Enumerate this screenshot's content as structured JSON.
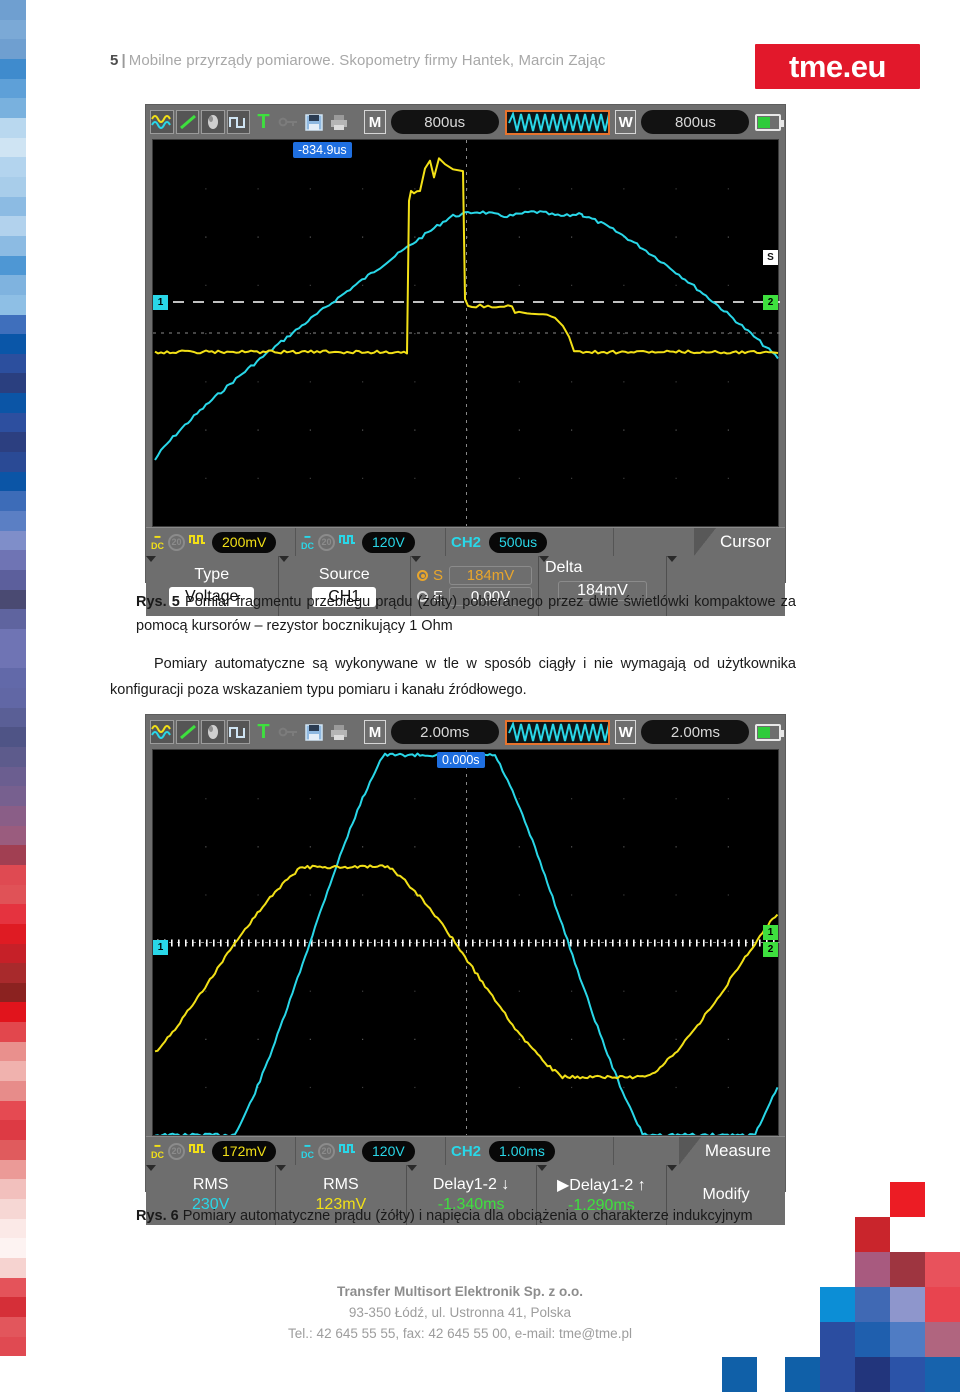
{
  "header": {
    "page_number": "5",
    "separator": "|",
    "title": "Mobilne przyrządy pomiarowe. Skopometry firmy Hantek, Marcin Zając",
    "logo_text": "tme.eu",
    "logo_color": "#e2182b"
  },
  "scope1": {
    "topbar": {
      "icons": [
        "waveform-icon",
        "slope-icon",
        "image-icon",
        "pulse-icon",
        "trigger-t-icon",
        "key-icon",
        "save-icon",
        "print-icon"
      ],
      "m_button": "M",
      "m_value": "800us",
      "w_button": "W",
      "w_value": "800us",
      "battery": "battery-icon"
    },
    "time_cursor_label": "-834.9us",
    "channel_markers": {
      "left": "1",
      "right": "2",
      "trig_level": "S"
    },
    "chanbar": {
      "ch1_coupling": "DC",
      "ch1_bw": "20",
      "ch1_probe": "probe-icon",
      "ch1_scale": "200mV",
      "ch2_coupling": "DC",
      "ch2_bw": "20",
      "ch2_probe": "probe-icon",
      "ch2_scale": "120V",
      "trig_source": "CH2",
      "timebase": "500us",
      "mode": "Cursor"
    },
    "menu": [
      {
        "label": "Type",
        "value": "Voltage"
      },
      {
        "label": "Source",
        "value": "CH1"
      }
    ],
    "cursor": {
      "start_letter": "S",
      "start_value": "184mV",
      "end_letter": "E",
      "end_value": "0.00V",
      "delta_label": "Delta",
      "delta_value": "184mV"
    }
  },
  "caption5": {
    "figure": "Rys. 5",
    "text": " Pomiar fragmentu przebiegu prądu (żółty) pobieranego przez dwie świetlówki kompaktowe za pomocą kursorów – rezystor bocznikujący 1 Ohm"
  },
  "paragraph1": "Pomiary automatyczne są wykonywane w tle w sposób ciągły i nie wymagają od użytkownika konfiguracji poza wskazaniem typu pomiaru i kanału źródłowego.",
  "scope2": {
    "topbar": {
      "m_button": "M",
      "m_value": "2.00ms",
      "w_button": "W",
      "w_value": "2.00ms"
    },
    "time_cursor_label": "0.000s",
    "channel_markers": {
      "left": "1",
      "right_top": "1",
      "right_bottom": "2"
    },
    "chanbar": {
      "ch1_coupling": "DC",
      "ch1_bw": "20",
      "ch1_scale": "172mV",
      "ch2_coupling": "DC",
      "ch2_bw": "20",
      "ch2_scale": "120V",
      "trig_source": "CH2",
      "timebase": "1.00ms",
      "mode": "Measure"
    },
    "measurements": [
      {
        "label": "RMS",
        "value": "230V",
        "color": "#29d7e8"
      },
      {
        "label": "RMS",
        "value": "123mV",
        "color": "#f2e017"
      },
      {
        "label": "Delay1-2 ↓",
        "value": "-1.340ms",
        "color": "#3ee03e"
      },
      {
        "label": "▶Delay1-2 ↑",
        "value": "-1.290ms",
        "color": "#3ee03e"
      }
    ],
    "modify_label": "Modify"
  },
  "caption6": {
    "figure": "Rys. 6",
    "text": " Pomiary automatyczne prądu (żółty) i napięcia dla obciążenia o charakterze indukcyjnym"
  },
  "footer": {
    "line1": "Transfer Multisort Elektronik Sp. z o.o.",
    "line2": "93-350 Łódź, ul. Ustronna 41, Polska",
    "line3": "Tel.: 42 645 55 55, fax: 42 645 55 00, e-mail: tme@tme.pl"
  },
  "colors": {
    "ch1_yellow": "#f2e017",
    "ch2_cyan": "#29d7e8",
    "accent_red": "#e2182b",
    "scope_gray": "#6e6e6e"
  },
  "edge_strip_bands": [
    "#6f9fd0",
    "#7ba9d6",
    "#6f9fd0",
    "#3f8bcd",
    "#5ea0d8",
    "#79b1de",
    "#b9d8ef",
    "#cfe4f3",
    "#b3d4ee",
    "#a8cdea",
    "#8cbbe3",
    "#b2d2ed",
    "#8cbbe3",
    "#4e97d4",
    "#7fb3df",
    "#8ebfe5",
    "#3f6fbc",
    "#0a56a8",
    "#2c4f9e",
    "#2a3f7f",
    "#0b55a6",
    "#2d4f9f",
    "#2c3f80",
    "#2a4a95",
    "#0b55a6",
    "#3d6cb8",
    "#5b7fc4",
    "#7f8ec9",
    "#6f74b4",
    "#5c5f9c",
    "#4a4a72",
    "#5f649f",
    "#6f74b4",
    "#6f74b4",
    "#6269a9",
    "#6167a5",
    "#5a5f96",
    "#4f5486",
    "#5d5b8c",
    "#6b5e90",
    "#77608f",
    "#8a5e87",
    "#9a5c7e",
    "#a13f52",
    "#df4a52",
    "#e05257",
    "#e5333f",
    "#df1b23",
    "#c62028",
    "#a82a2c",
    "#8b2220",
    "#e1141c",
    "#e2474d",
    "#e9908d",
    "#f0b2ae",
    "#e78c8a",
    "#e54a52",
    "#dd3a44",
    "#e05b5d",
    "#eb9a97",
    "#f2c0bd",
    "#f6d7d4",
    "#fbe9e7",
    "#fdf3f2",
    "#f6d3d0",
    "#e4535a",
    "#d52f38",
    "#e2565c",
    "#e04a52"
  ]
}
